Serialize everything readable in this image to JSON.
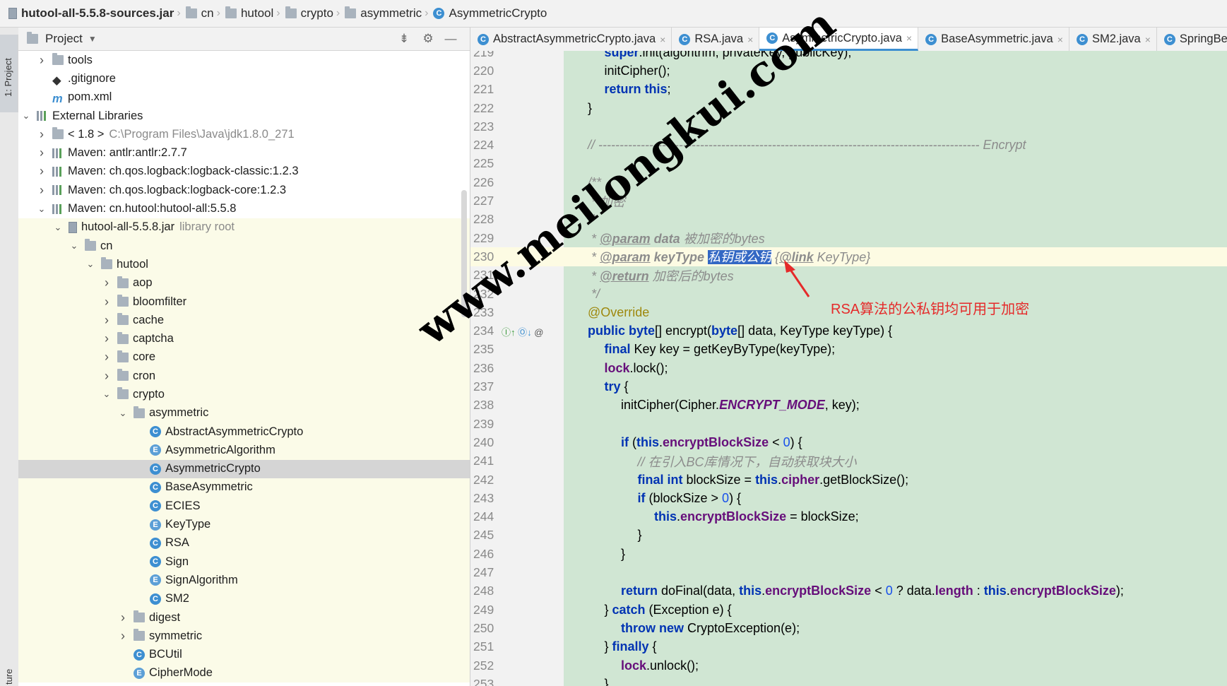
{
  "breadcrumb": [
    "hutool-all-5.5.8-sources.jar",
    "cn",
    "hutool",
    "crypto",
    "asymmetric",
    "AsymmetricCrypto"
  ],
  "left_strip": {
    "project_label": "1: Project",
    "structure_label": "ture"
  },
  "project_panel": {
    "title": "Project",
    "tree": [
      {
        "label": "tools",
        "arrow": "right",
        "indent": 0,
        "icon": "folder"
      },
      {
        "label": ".gitignore",
        "arrow": "",
        "indent": 0,
        "icon": "git"
      },
      {
        "label": "pom.xml",
        "arrow": "",
        "indent": 0,
        "icon": "maven"
      },
      {
        "label": "External Libraries",
        "arrow": "down",
        "indent": -1,
        "icon": "libs"
      },
      {
        "label": "< 1.8 >",
        "extra": "C:\\Program Files\\Java\\jdk1.8.0_271",
        "arrow": "right",
        "indent": 0,
        "icon": "folder"
      },
      {
        "label": "Maven: antlr:antlr:2.7.7",
        "arrow": "right",
        "indent": 0,
        "icon": "libs"
      },
      {
        "label": "Maven: ch.qos.logback:logback-classic:1.2.3",
        "arrow": "right",
        "indent": 0,
        "icon": "libs"
      },
      {
        "label": "Maven: ch.qos.logback:logback-core:1.2.3",
        "arrow": "right",
        "indent": 0,
        "icon": "libs"
      },
      {
        "label": "Maven: cn.hutool:hutool-all:5.5.8",
        "arrow": "down",
        "indent": 0,
        "icon": "libs"
      },
      {
        "label": "hutool-all-5.5.8.jar",
        "extra": "library root",
        "arrow": "down",
        "indent": 1,
        "icon": "jar",
        "lib": true
      },
      {
        "label": "cn",
        "arrow": "down",
        "indent": 2,
        "icon": "folder",
        "lib": true
      },
      {
        "label": "hutool",
        "arrow": "down",
        "indent": 3,
        "icon": "folder",
        "lib": true
      },
      {
        "label": "aop",
        "arrow": "right",
        "indent": 4,
        "icon": "folder",
        "lib": true
      },
      {
        "label": "bloomfilter",
        "arrow": "right",
        "indent": 4,
        "icon": "folder",
        "lib": true
      },
      {
        "label": "cache",
        "arrow": "right",
        "indent": 4,
        "icon": "folder",
        "lib": true
      },
      {
        "label": "captcha",
        "arrow": "right",
        "indent": 4,
        "icon": "folder",
        "lib": true
      },
      {
        "label": "core",
        "arrow": "right",
        "indent": 4,
        "icon": "folder",
        "lib": true
      },
      {
        "label": "cron",
        "arrow": "right",
        "indent": 4,
        "icon": "folder",
        "lib": true
      },
      {
        "label": "crypto",
        "arrow": "down",
        "indent": 4,
        "icon": "folder",
        "lib": true
      },
      {
        "label": "asymmetric",
        "arrow": "down",
        "indent": 5,
        "icon": "folder",
        "lib": true
      },
      {
        "label": "AbstractAsymmetricCrypto",
        "arrow": "",
        "indent": 6,
        "icon": "class",
        "lib": true
      },
      {
        "label": "AsymmetricAlgorithm",
        "arrow": "",
        "indent": 6,
        "icon": "enum",
        "lib": true
      },
      {
        "label": "AsymmetricCrypto",
        "arrow": "",
        "indent": 6,
        "icon": "class",
        "selected": true
      },
      {
        "label": "BaseAsymmetric",
        "arrow": "",
        "indent": 6,
        "icon": "class",
        "lib": true
      },
      {
        "label": "ECIES",
        "arrow": "",
        "indent": 6,
        "icon": "class",
        "lib": true
      },
      {
        "label": "KeyType",
        "arrow": "",
        "indent": 6,
        "icon": "enum",
        "lib": true
      },
      {
        "label": "RSA",
        "arrow": "",
        "indent": 6,
        "icon": "class",
        "lib": true
      },
      {
        "label": "Sign",
        "arrow": "",
        "indent": 6,
        "icon": "class",
        "lib": true
      },
      {
        "label": "SignAlgorithm",
        "arrow": "",
        "indent": 6,
        "icon": "enum",
        "lib": true
      },
      {
        "label": "SM2",
        "arrow": "",
        "indent": 6,
        "icon": "class",
        "lib": true
      },
      {
        "label": "digest",
        "arrow": "right",
        "indent": 5,
        "icon": "folder",
        "lib": true
      },
      {
        "label": "symmetric",
        "arrow": "right",
        "indent": 5,
        "icon": "folder",
        "lib": true
      },
      {
        "label": "BCUtil",
        "arrow": "",
        "indent": 5,
        "icon": "class",
        "lib": true
      },
      {
        "label": "CipherMode",
        "arrow": "",
        "indent": 5,
        "icon": "enum",
        "lib": true
      }
    ]
  },
  "editor_tabs": [
    {
      "label": "AbstractAsymmetricCrypto.java",
      "active": false
    },
    {
      "label": "RSA.java",
      "active": false
    },
    {
      "label": "AsymmetricCrypto.java",
      "active": true
    },
    {
      "label": "BaseAsymmetric.java",
      "active": false
    },
    {
      "label": "SM2.java",
      "active": false
    },
    {
      "label": "SpringBe",
      "active": false
    }
  ],
  "code_lines": [
    {
      "n": "219",
      "html": "<span class='kw'>super</span>.init(algorithm, privateKey, publicKey);",
      "indent": 2
    },
    {
      "n": "220",
      "html": "initCipher();",
      "indent": 2
    },
    {
      "n": "221",
      "html": "<span class='kw'>return this</span>;",
      "indent": 2
    },
    {
      "n": "222",
      "html": "}",
      "indent": 1
    },
    {
      "n": "223",
      "html": "",
      "indent": 1
    },
    {
      "n": "224",
      "html": "<span class='cm'>// ------------------------------------------------------------------------------------------ Encrypt</span>",
      "indent": 1
    },
    {
      "n": "225",
      "html": "",
      "indent": 1
    },
    {
      "n": "226",
      "html": "<span class='cm'>/**</span>",
      "indent": 1
    },
    {
      "n": "227",
      "html": "<span class='cm'> * 加密</span>",
      "indent": 1
    },
    {
      "n": "228",
      "html": "<span class='cm'> *</span>",
      "indent": 1
    },
    {
      "n": "229",
      "html": "<span class='cm'> * </span><span class='doctag'>@param</span><span class='cm'> <b>data</b> 被加密的bytes</span>",
      "indent": 1
    },
    {
      "n": "230",
      "html": "<span class='cm'> * </span><span class='doctag'>@param</span><span class='cm'> <b>keyType</b> </span><span class='sel'>私钥或公钥</span><span class='cm'> {</span><span class='doctag'>@link</span><span class='cm'> KeyType}</span>",
      "indent": 1,
      "hl": true
    },
    {
      "n": "231",
      "html": "<span class='cm'> * </span><span class='doctag'>@return</span><span class='cm'> 加密后的bytes</span>",
      "indent": 1
    },
    {
      "n": "232",
      "html": "<span class='cm'> */</span>",
      "indent": 1
    },
    {
      "n": "233",
      "html": "<span class='ann'>@Override</span>",
      "indent": 1
    },
    {
      "n": "234",
      "html": "<span class='kw'>public byte</span>[] encrypt(<span class='kw'>byte</span>[] data, KeyType keyType) {",
      "indent": 1
    },
    {
      "n": "235",
      "html": "<span class='kw'>final</span> Key key = getKeyByType(keyType);",
      "indent": 2
    },
    {
      "n": "236",
      "html": "<span class='fld'>lock</span>.lock();",
      "indent": 2
    },
    {
      "n": "237",
      "html": "<span class='kw'>try</span> {",
      "indent": 2
    },
    {
      "n": "238",
      "html": "initCipher(Cipher.<span class='sfld'>ENCRYPT_MODE</span>, key);",
      "indent": 3
    },
    {
      "n": "239",
      "html": "",
      "indent": 3
    },
    {
      "n": "240",
      "html": "<span class='kw'>if</span> (<span class='kw'>this</span>.<span class='fld'>encryptBlockSize</span> &lt; <span class='num0'>0</span>) {",
      "indent": 3
    },
    {
      "n": "241",
      "html": "<span class='cm'>// 在引入BC库情况下，自动获取块大小</span>",
      "indent": 4
    },
    {
      "n": "242",
      "html": "<span class='kw'>final int</span> blockSize = <span class='kw'>this</span>.<span class='fld'>cipher</span>.getBlockSize();",
      "indent": 4
    },
    {
      "n": "243",
      "html": "<span class='kw'>if</span> (blockSize &gt; <span class='num0'>0</span>) {",
      "indent": 4
    },
    {
      "n": "244",
      "html": "<span class='kw'>this</span>.<span class='fld'>encryptBlockSize</span> = blockSize;",
      "indent": 5
    },
    {
      "n": "245",
      "html": "}",
      "indent": 4
    },
    {
      "n": "246",
      "html": "}",
      "indent": 3
    },
    {
      "n": "247",
      "html": "",
      "indent": 3
    },
    {
      "n": "248",
      "html": "<span class='kw'>return</span> doFinal(data, <span class='kw'>this</span>.<span class='fld'>encryptBlockSize</span> &lt; <span class='num0'>0</span> ? data.<span class='fld'>length</span> : <span class='kw'>this</span>.<span class='fld'>encryptBlockSize</span>);",
      "indent": 3
    },
    {
      "n": "249",
      "html": "} <span class='kw'>catch</span> (Exception e) {",
      "indent": 2
    },
    {
      "n": "250",
      "html": "<span class='kw'>throw new</span> CryptoException(e);",
      "indent": 3
    },
    {
      "n": "251",
      "html": "} <span class='kw'>finally</span> {",
      "indent": 2
    },
    {
      "n": "252",
      "html": "<span class='fld'>lock</span>.unlock();",
      "indent": 3
    },
    {
      "n": "253",
      "html": "}",
      "indent": 2
    }
  ],
  "annotation_note": "RSA算法的公私钥均可用于加密",
  "watermark": "www.meilongkui.com",
  "colors": {
    "code_bg": "#d0e6d3",
    "selection": "#3468c4",
    "note_red": "#e52a2a"
  }
}
